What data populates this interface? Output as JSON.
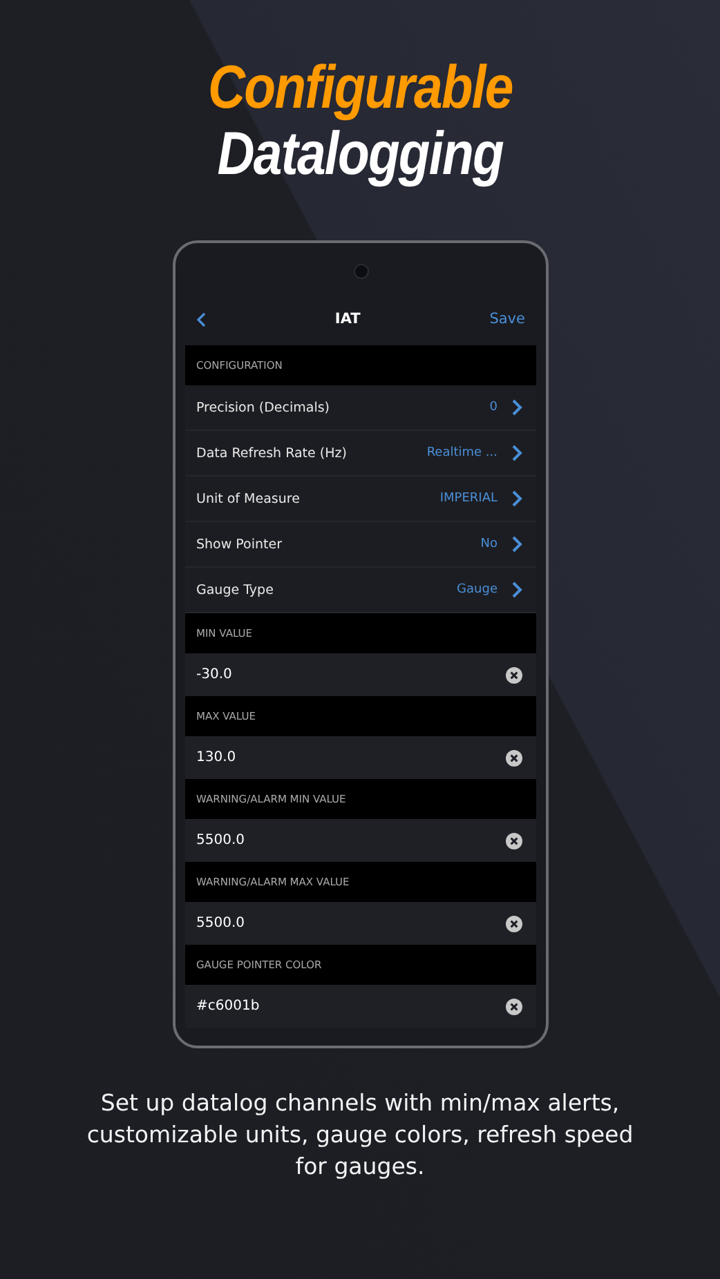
{
  "headline": {
    "line_1": "Configurable",
    "line_2": "Datalogging"
  },
  "screen": {
    "nav": {
      "title": "IAT",
      "action": "Save"
    },
    "configuration": {
      "header": "CONFIGURATION",
      "rows": [
        {
          "label": "Precision (Decimals)",
          "value": "0"
        },
        {
          "label": "Data Refresh Rate (Hz)",
          "value": "Realtime ..."
        },
        {
          "label": "Unit of Measure",
          "value": "IMPERIAL"
        },
        {
          "label": "Show Pointer",
          "value": "No"
        },
        {
          "label": "Gauge Type",
          "value": "Gauge"
        }
      ]
    },
    "fields": [
      {
        "header": "MIN VALUE",
        "value": "-30.0"
      },
      {
        "header": "MAX VALUE",
        "value": "130.0"
      },
      {
        "header": "WARNING/ALARM MIN VALUE",
        "value": "5500.0"
      },
      {
        "header": "WARNING/ALARM MAX VALUE",
        "value": "5500.0"
      },
      {
        "header": "GAUGE POINTER COLOR",
        "value": "#c6001b"
      }
    ]
  },
  "caption": "Set up datalog channels with min/max alerts, customizable units, gauge colors, refresh speed for gauges."
}
